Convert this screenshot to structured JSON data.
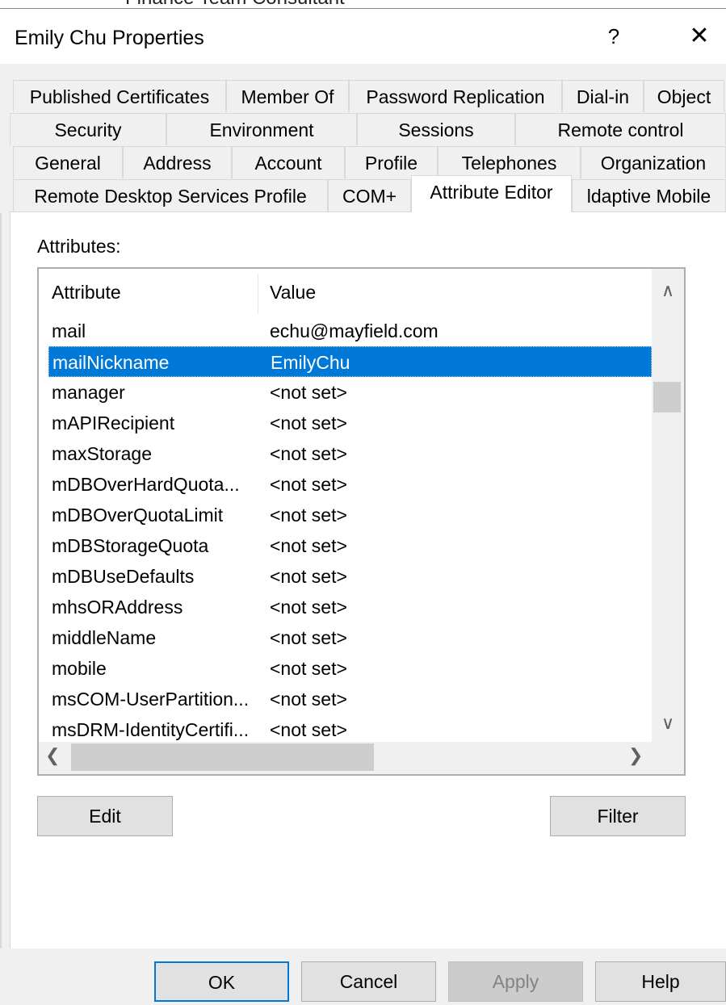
{
  "backdrop_text": "Finance Team Consultant",
  "window": {
    "title": "Emily Chu Properties",
    "help_label": "?",
    "close_label": "✕"
  },
  "tabs": {
    "row1": [
      "Published Certificates",
      "Member Of",
      "Password Replication",
      "Dial-in",
      "Object"
    ],
    "row2": [
      "Security",
      "Environment",
      "Sessions",
      "Remote control"
    ],
    "row3": [
      "General",
      "Address",
      "Account",
      "Profile",
      "Telephones",
      "Organization"
    ],
    "row4": [
      "Remote Desktop Services Profile",
      "COM+",
      "Attribute Editor",
      "ldaptive Mobile"
    ],
    "active": "Attribute Editor"
  },
  "attributes_label": "Attributes:",
  "table": {
    "columns": [
      "Attribute",
      "Value"
    ],
    "rows": [
      {
        "attribute": "mail",
        "value": "echu@mayfield.com"
      },
      {
        "attribute": "mailNickname",
        "value": "EmilyChu"
      },
      {
        "attribute": "manager",
        "value": "<not set>"
      },
      {
        "attribute": "mAPIRecipient",
        "value": "<not set>"
      },
      {
        "attribute": "maxStorage",
        "value": "<not set>"
      },
      {
        "attribute": "mDBOverHardQuota...",
        "value": "<not set>"
      },
      {
        "attribute": "mDBOverQuotaLimit",
        "value": "<not set>"
      },
      {
        "attribute": "mDBStorageQuota",
        "value": "<not set>"
      },
      {
        "attribute": "mDBUseDefaults",
        "value": "<not set>"
      },
      {
        "attribute": "mhsORAddress",
        "value": "<not set>"
      },
      {
        "attribute": "middleName",
        "value": "<not set>"
      },
      {
        "attribute": "mobile",
        "value": "<not set>"
      },
      {
        "attribute": "msCOM-UserPartition...",
        "value": "<not set>"
      },
      {
        "attribute": "msDRM-IdentityCertifi...",
        "value": "<not set>"
      }
    ],
    "selected_attribute": "mailNickname"
  },
  "icons": {
    "scroll_up": "chevron-up-icon",
    "scroll_down": "chevron-down-icon",
    "scroll_left": "chevron-left-icon",
    "scroll_right": "chevron-right-icon"
  },
  "buttons": {
    "edit": "Edit",
    "filter": "Filter",
    "ok": "OK",
    "cancel": "Cancel",
    "apply": "Apply",
    "help": "Help"
  },
  "colors": {
    "selection": "#0078d7",
    "window_bg": "#f0f0f0",
    "panel_bg": "#ffffff"
  }
}
